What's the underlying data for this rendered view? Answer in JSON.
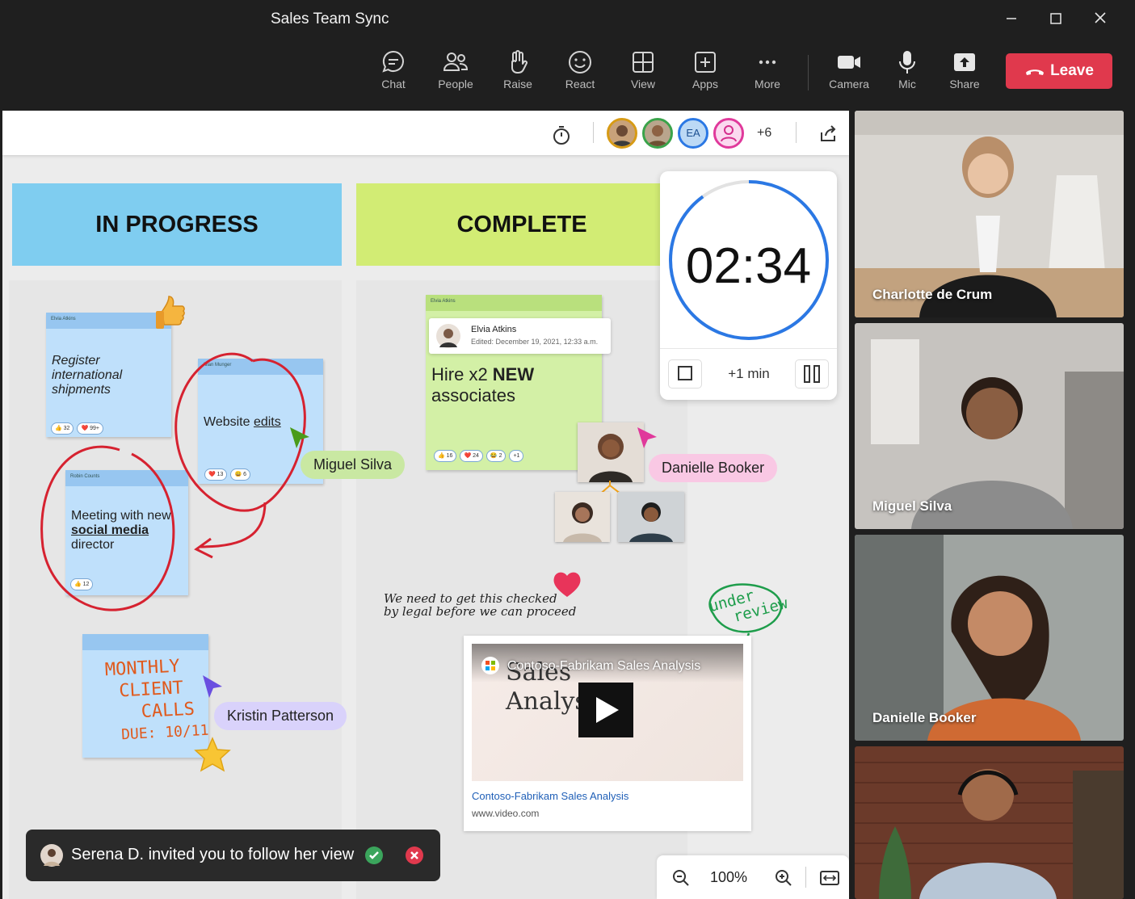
{
  "window": {
    "title": "Sales Team Sync",
    "min": "—",
    "max": "☐",
    "close": "✕"
  },
  "toolbar": {
    "chat": "Chat",
    "people": "People",
    "raise": "Raise",
    "react": "React",
    "view": "View",
    "apps": "Apps",
    "more": "More",
    "camera": "Camera",
    "mic": "Mic",
    "share": "Share",
    "leave": "Leave"
  },
  "board": {
    "avatars": [
      "",
      "",
      "EA",
      ""
    ],
    "overflow": "+6",
    "lanes": {
      "in_progress": "IN PROGRESS",
      "complete": "COMPLETE"
    },
    "notes": {
      "register": {
        "author": "Elvia Atkins",
        "text": "Register international shipments",
        "r1": "👍 32",
        "r2": "❤️ 99+"
      },
      "website": {
        "author": "Allan Munger",
        "text_a": "Website ",
        "text_b": "edits",
        "r1": "❤️ 13",
        "r2": "😀 6"
      },
      "meeting": {
        "author": "Robin Counts",
        "text_a": "Meeting with new ",
        "text_b": "social media",
        "text_c": " director",
        "r1": "👍 12"
      },
      "monthly": {
        "line1": "MONTHLY",
        "line2": "CLIENT",
        "line3": "CALLS",
        "line4": "DUE: 10/11"
      },
      "hire": {
        "author": "Elvia Atkins",
        "card_name": "Elvia Atkins",
        "card_edited": "Edited: December 19, 2021, 12:33 a.m.",
        "text_a": "Hire x2 ",
        "text_b": "NEW",
        "text_c": " associates",
        "r1": "👍 16",
        "r2": "❤️ 24",
        "r3": "😂 2",
        "r4": "+1"
      }
    },
    "cursors": {
      "miguel": "Miguel Silva",
      "danielle": "Danielle Booker",
      "kristin": "Kristin Patterson"
    },
    "handwriting": {
      "legal_line1": "We need to get this checked",
      "legal_line2": "by legal before we can proceed",
      "under_review_1": "under",
      "under_review_2": "review"
    },
    "video": {
      "title": "Contoso-Fabrikam Sales Analysis",
      "thumb_l1": "Sales",
      "thumb_l2": "Analysis",
      "link": "Contoso-Fabrikam Sales Analysis",
      "domain": "www.video.com"
    },
    "timer": {
      "time": "02:34",
      "add": "+1 min",
      "progress": 0.9
    },
    "zoom": "100%",
    "toast": "Serena D. invited you to follow her view"
  },
  "participants": [
    {
      "name": "Charlotte de Crum"
    },
    {
      "name": "Miguel Silva"
    },
    {
      "name": "Danielle Booker"
    },
    {
      "name": ""
    }
  ],
  "colors": {
    "in_progress": "#7fcdf0",
    "complete": "#d2ec74",
    "leave": "#e0394d",
    "accent": "#2b78e4"
  }
}
